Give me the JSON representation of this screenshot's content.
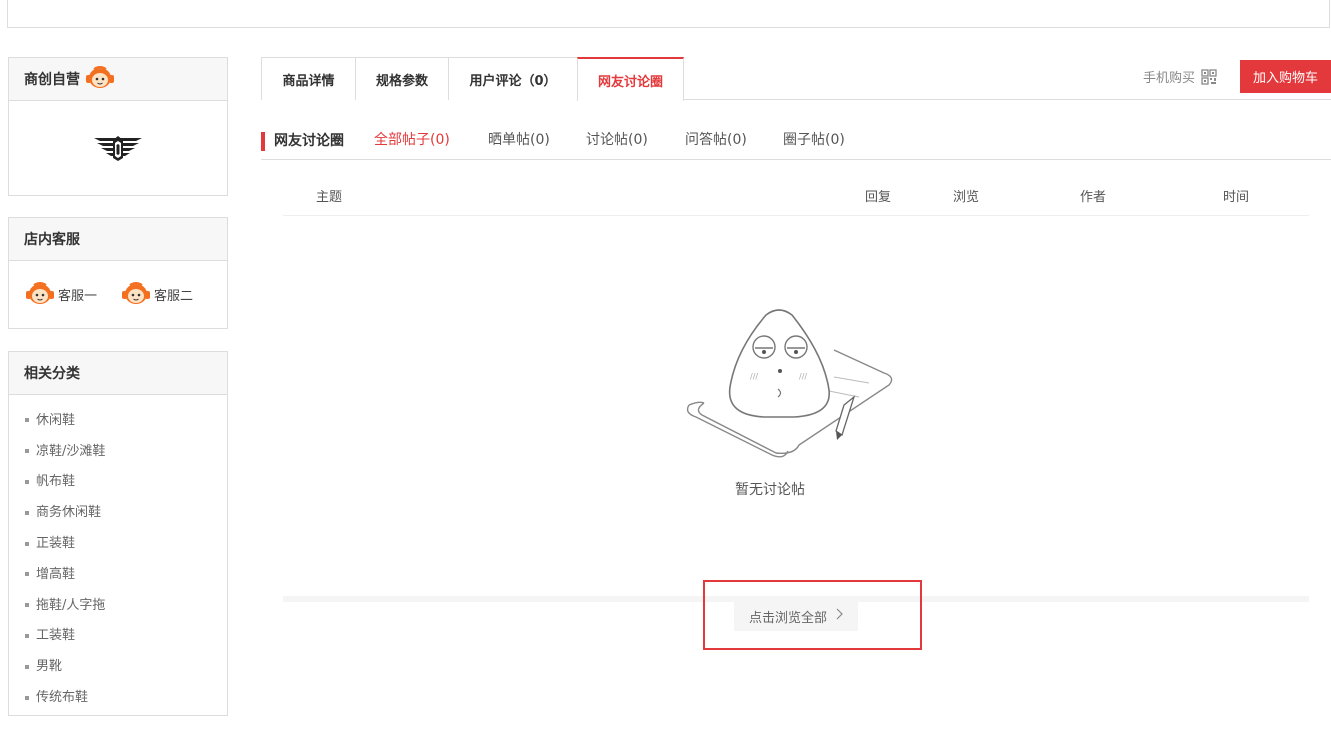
{
  "store": {
    "name": "商创自营"
  },
  "customer_service": {
    "title": "店内客服",
    "agents": [
      {
        "label": "客服一"
      },
      {
        "label": "客服二"
      }
    ]
  },
  "categories": {
    "title": "相关分类",
    "items": [
      "休闲鞋",
      "凉鞋/沙滩鞋",
      "帆布鞋",
      "商务休闲鞋",
      "正装鞋",
      "增高鞋",
      "拖鞋/人字拖",
      "工装鞋",
      "男靴",
      "传统布鞋"
    ]
  },
  "tabs": [
    {
      "label": "商品详情",
      "active": false
    },
    {
      "label": "规格参数",
      "active": false
    },
    {
      "label": "用户评论（0）",
      "active": false
    },
    {
      "label": "网友讨论圈",
      "active": true
    }
  ],
  "header_actions": {
    "phone_buy": "手机购买",
    "add_to_cart": "加入购物车"
  },
  "discussion": {
    "title": "网友讨论圈",
    "filters": [
      {
        "label": "全部帖子(0)",
        "active": true
      },
      {
        "label": "晒单帖(0)",
        "active": false
      },
      {
        "label": "讨论帖(0)",
        "active": false
      },
      {
        "label": "问答帖(0)",
        "active": false
      },
      {
        "label": "圈子帖(0)",
        "active": false
      }
    ],
    "columns": [
      "主题",
      "回复",
      "浏览",
      "作者",
      "时间"
    ],
    "empty_text": "暂无讨论帖",
    "browse_all": "点击浏览全部"
  },
  "colors": {
    "accent": "#e4393c",
    "border": "#dddddd",
    "mascot": "#f37021"
  },
  "icons": {
    "mascot": "monkey-mascot-icon",
    "qr": "qr-code-icon",
    "chevron": "chevron-right-icon"
  }
}
